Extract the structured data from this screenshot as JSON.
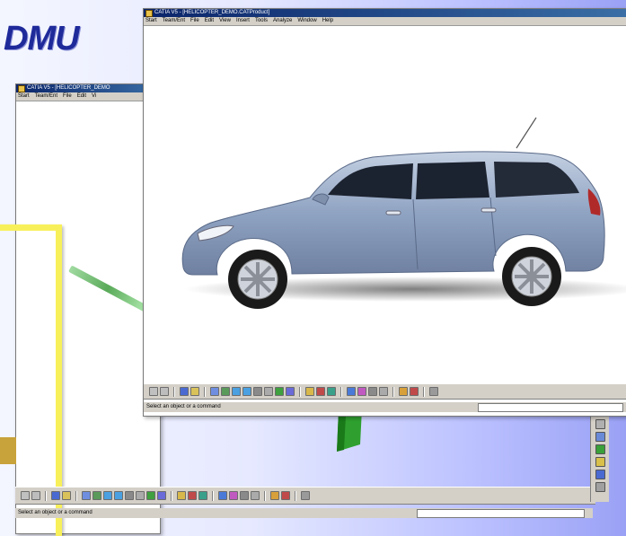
{
  "slide": {
    "title": "DMU"
  },
  "front_window": {
    "title": "CATIA V5 - [HELICOPTER_DEMO.CATProduct]",
    "menu": [
      "Start",
      "Team/Ent",
      "File",
      "Edit",
      "View",
      "Insert",
      "Tools",
      "Analyze",
      "Window",
      "Help"
    ],
    "status_text": "Select an object or a command"
  },
  "back_window": {
    "title": "CATIA V5 - [HELICOPTER_DEMO",
    "menu": [
      "Start",
      "Team/Ent",
      "File",
      "Edit",
      "Vi"
    ],
    "status_text": "Select an object or a command"
  },
  "colors": {
    "car_body": "#8fa3c2",
    "title_blue": "#1f2a9a",
    "frame_yellow": "#f8f05a",
    "toolbar_gray": "#d4d0c8"
  },
  "toolbar_icons": [
    "snap-icon",
    "select-icon",
    "sketch-icon",
    "measure-icon",
    "pan-icon",
    "rotate-icon",
    "zoom-in-icon",
    "zoom-out-icon",
    "normal-view-icon",
    "fit-all-icon",
    "shading-icon",
    "render-icon",
    "hide-show-icon",
    "swap-icon",
    "compass-icon",
    "clash-icon",
    "section-icon",
    "distance-icon",
    "annotate-icon",
    "spin-icon",
    "scene-icon",
    "help-icon"
  ]
}
